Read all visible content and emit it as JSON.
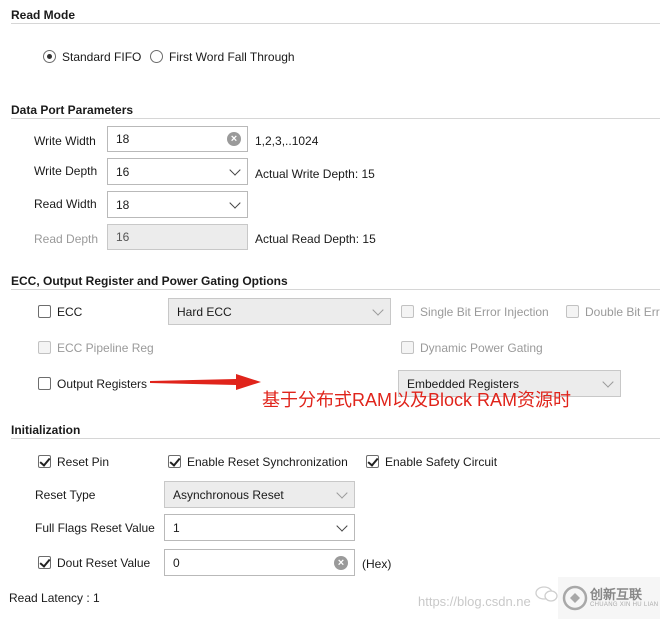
{
  "read_mode": {
    "title": "Read Mode",
    "option_standard": "Standard FIFO",
    "option_fwft": "First Word Fall Through"
  },
  "data_port": {
    "title": "Data Port Parameters",
    "write_width_label": "Write Width",
    "write_width_value": "18",
    "write_width_hint": "1,2,3,..1024",
    "write_depth_label": "Write Depth",
    "write_depth_value": "16",
    "write_depth_hint": "Actual Write Depth: 15",
    "read_width_label": "Read Width",
    "read_width_value": "18",
    "read_depth_label": "Read Depth",
    "read_depth_value": "16",
    "read_depth_hint": "Actual Read Depth: 15"
  },
  "ecc": {
    "title": "ECC, Output Register and Power Gating Options",
    "ecc_label": "ECC",
    "ecc_type_value": "Hard ECC",
    "single_bit_label": "Single Bit Error Injection",
    "double_bit_label": "Double Bit Err",
    "pipeline_label": "ECC Pipeline Reg",
    "power_gating_label": "Dynamic Power Gating",
    "output_registers_label": "Output Registers",
    "output_registers_value": "Embedded Registers"
  },
  "annotation": {
    "text": "基于分布式RAM以及Block RAM资源时",
    "color": "#e0241b"
  },
  "init": {
    "title": "Initialization",
    "reset_pin_label": "Reset Pin",
    "reset_sync_label": "Enable Reset Synchronization",
    "safety_label": "Enable Safety Circuit",
    "reset_type_label": "Reset Type",
    "reset_type_value": "Asynchronous Reset",
    "full_flags_label": "Full Flags Reset Value",
    "full_flags_value": "1",
    "dout_label": "Dout Reset Value",
    "dout_value": "0",
    "dout_unit": "(Hex)"
  },
  "read_latency": "Read Latency : 1",
  "watermark": {
    "url": "https://blog.csdn.ne",
    "brand_cn": "创新互联",
    "brand_en": "CHUANG XIN HU LIAN"
  }
}
